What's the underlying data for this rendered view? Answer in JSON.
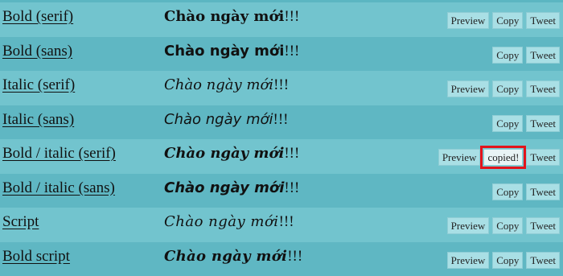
{
  "rows": [
    {
      "style_name": "Bold (serif)",
      "sample_main": "Chào ngày mới",
      "sample_tail": "!!!",
      "buttons": [
        "Preview",
        "Copy",
        "Tweet"
      ]
    },
    {
      "style_name": "Bold (sans)",
      "sample_main": "Chào ngày mới",
      "sample_tail": "!!!",
      "buttons": [
        "Copy",
        "Tweet"
      ]
    },
    {
      "style_name": "Italic (serif)",
      "sample_main": "Chào ngày mới",
      "sample_tail": "!!!",
      "buttons": [
        "Preview",
        "Copy",
        "Tweet"
      ]
    },
    {
      "style_name": "Italic (sans)",
      "sample_main": "Chào ngày mới",
      "sample_tail": "!!!",
      "buttons": [
        "Copy",
        "Tweet"
      ]
    },
    {
      "style_name": "Bold / italic (serif)",
      "sample_main": "Chào ngày mới",
      "sample_tail": "!!!",
      "buttons": [
        "Preview",
        "copied!",
        "Tweet"
      ]
    },
    {
      "style_name": "Bold / italic (sans)",
      "sample_main": "Chào ngày mới",
      "sample_tail": "!!!",
      "buttons": [
        "Copy",
        "Tweet"
      ]
    },
    {
      "style_name": "Script",
      "sample_main": "Chào ngày mới",
      "sample_tail": "!!!",
      "buttons": [
        "Preview",
        "Copy",
        "Tweet"
      ]
    },
    {
      "style_name": "Bold script",
      "sample_main": "Chào ngày mới",
      "sample_tail": "!!!",
      "buttons": [
        "Preview",
        "Copy",
        "Tweet"
      ]
    }
  ],
  "colors": {
    "row_light": "#72c4ce",
    "row_dark": "#5fb7c3",
    "button_bg": "#a9dfe5",
    "highlight": "#e3131b"
  }
}
